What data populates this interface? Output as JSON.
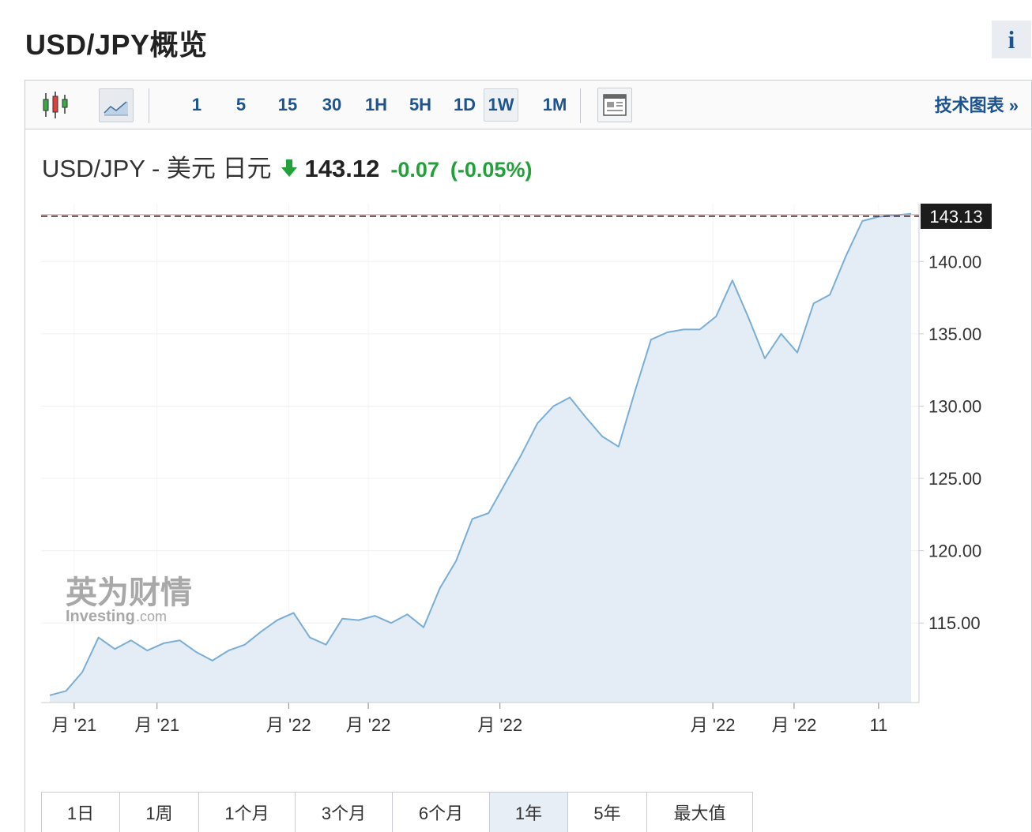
{
  "page": {
    "title": "USD/JPY概览",
    "info_icon": "i"
  },
  "toolbar": {
    "chart_type_icons": [
      "candlestick-icon",
      "area-chart-icon"
    ],
    "intervals": [
      {
        "label": "1",
        "active": false
      },
      {
        "label": "5",
        "active": false
      },
      {
        "label": "15",
        "active": false
      },
      {
        "label": "30",
        "active": false
      },
      {
        "label": "1H",
        "active": false
      },
      {
        "label": "5H",
        "active": false
      },
      {
        "label": "1D",
        "active": false
      },
      {
        "label": "1W",
        "active": true
      },
      {
        "label": "1M",
        "active": false
      }
    ],
    "layout_icon": "news-layout-icon",
    "tech_chart_link": "技术图表 »"
  },
  "quote": {
    "name": "USD/JPY - 美元 日元",
    "direction_icon": "arrow-down-icon",
    "price": "143.12",
    "change": "-0.07",
    "change_pct": "(-0.05%)"
  },
  "colors": {
    "up_down_green": "#22a03a",
    "line": "#7aaed6",
    "area": "#e4edf6",
    "link": "#1d5390"
  },
  "watermark": {
    "cn": "英为财情",
    "en": "Investing",
    "suffix": ".com"
  },
  "chart_data": {
    "type": "area",
    "ylim": [
      109.5,
      144.0
    ],
    "y_ticks": [
      115,
      120,
      125,
      130,
      135,
      140
    ],
    "y_tick_labels": [
      "115.00",
      "120.00",
      "125.00",
      "130.00",
      "135.00",
      "140.00"
    ],
    "last_price_label": "143.13",
    "last_price": 143.13,
    "x_tick_labels": [
      "月 '21",
      "月 '21",
      "月 '22",
      "月 '22",
      "月 '22",
      "月 '22",
      "月 '22",
      "11"
    ],
    "x_tick_positions": [
      1.5,
      6.6,
      14.7,
      19.6,
      27.7,
      40.8,
      45.8,
      51.0
    ],
    "values": [
      110.0,
      110.3,
      111.6,
      114.0,
      113.2,
      113.8,
      113.1,
      113.6,
      113.8,
      113.0,
      112.4,
      113.1,
      113.5,
      114.4,
      115.2,
      115.7,
      114.0,
      113.5,
      115.3,
      115.2,
      115.5,
      115.0,
      115.6,
      114.7,
      117.4,
      119.3,
      122.2,
      122.6,
      124.6,
      126.6,
      128.8,
      130.0,
      130.6,
      129.2,
      127.9,
      127.2,
      131.0,
      134.6,
      135.1,
      135.3,
      135.3,
      136.2,
      138.7,
      136.1,
      133.3,
      135.0,
      133.7,
      137.1,
      137.7,
      140.4,
      142.8,
      143.1,
      143.2,
      143.3
    ]
  },
  "range_buttons": [
    {
      "label": "1日",
      "active": false
    },
    {
      "label": "1周",
      "active": false
    },
    {
      "label": "1个月",
      "active": false
    },
    {
      "label": "3个月",
      "active": false
    },
    {
      "label": "6个月",
      "active": false
    },
    {
      "label": "1年",
      "active": true
    },
    {
      "label": "5年",
      "active": false
    },
    {
      "label": "最大值",
      "active": false
    }
  ]
}
